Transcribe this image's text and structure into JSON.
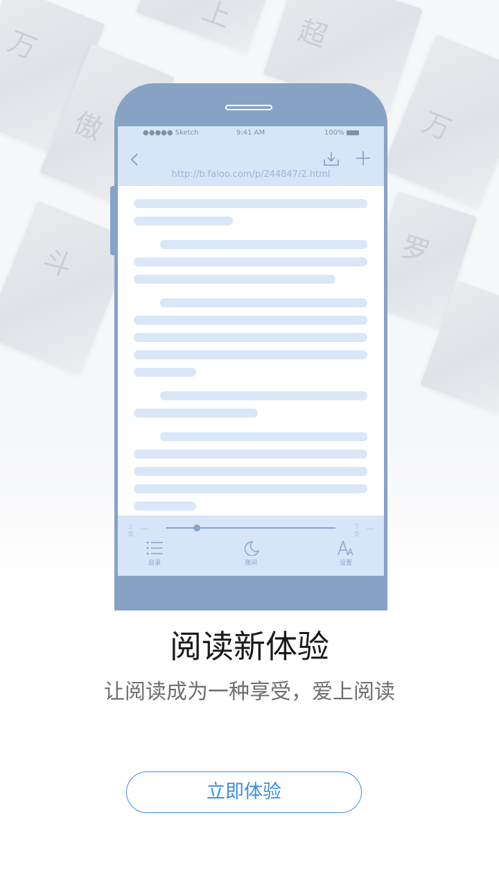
{
  "phone": {
    "status": {
      "carrier": "●●●●● Sketch",
      "time": "9:41 AM",
      "battery": "100%"
    },
    "url": "http://b.faloo.com/p/244847/2.html",
    "toolbar": {
      "prev_chapter": "上章",
      "next_chapter": "下章",
      "progress": 0.18,
      "items": [
        {
          "label": "目录",
          "icon": "list-icon"
        },
        {
          "label": "夜间",
          "icon": "moon-icon"
        },
        {
          "label": "设置",
          "icon": "font-settings-icon"
        }
      ]
    }
  },
  "headline": "阅读新体验",
  "subheadline": "让阅读成为一种享受，爱上阅读",
  "cta_label": "立即体验",
  "colors": {
    "accent": "#3a8ee6",
    "phone_frame": "#86a3c6",
    "screen_tint": "#d6e5f8",
    "placeholder_line": "#d9e7f9"
  }
}
